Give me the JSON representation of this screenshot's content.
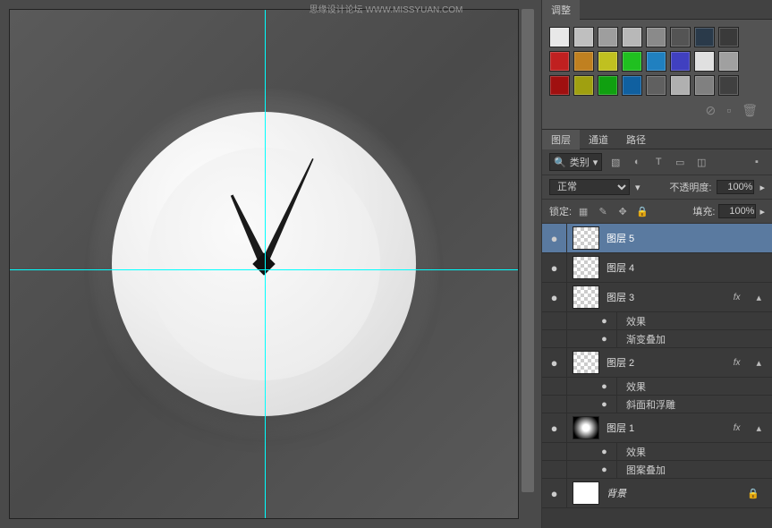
{
  "watermark": "思缘设计论坛   WWW.MISSYUAN.COM",
  "adjustments": {
    "tab": "调整"
  },
  "swatches": {
    "row1": [
      "#e8e8e8",
      "#bfbfbf",
      "#9e9e9e",
      "#b8b8b8",
      "#8a8a8a",
      "#545454",
      "#2a3a4a",
      "#3a3a3a"
    ],
    "row2": [
      "#c02020",
      "#c08020",
      "#c0c020",
      "#20c020",
      "#2080c0",
      "#4040c0",
      "#e0e0e0",
      "#a0a0a0"
    ],
    "row3": [
      "#a01010",
      "#a0a010",
      "#10a010",
      "#1060a0",
      "#606060",
      "#b0b0b0",
      "#808080",
      "#404040"
    ]
  },
  "layersPanel": {
    "tabs": {
      "layers": "图层",
      "channels": "通道",
      "paths": "路径"
    },
    "filter": {
      "label": "类别"
    },
    "blend": {
      "mode": "正常",
      "opacityLabel": "不透明度:",
      "opacity": "100%",
      "fillLabel": "填充:",
      "fill": "100%",
      "lockLabel": "锁定:"
    },
    "layers": [
      {
        "name": "图层 5",
        "selected": true,
        "thumb": "trans"
      },
      {
        "name": "图层 4",
        "thumb": "trans"
      },
      {
        "name": "图层 3",
        "thumb": "trans",
        "fx": true,
        "effects": [
          "效果",
          "渐变叠加"
        ]
      },
      {
        "name": "图层 2",
        "thumb": "trans",
        "fx": true,
        "effects": [
          "效果",
          "斜面和浮雕"
        ]
      },
      {
        "name": "图层 1",
        "thumb": "radial",
        "fx": true,
        "effects": [
          "效果",
          "图案叠加"
        ]
      },
      {
        "name": "背景",
        "thumb": "white",
        "locked": true,
        "italic": true
      }
    ]
  }
}
